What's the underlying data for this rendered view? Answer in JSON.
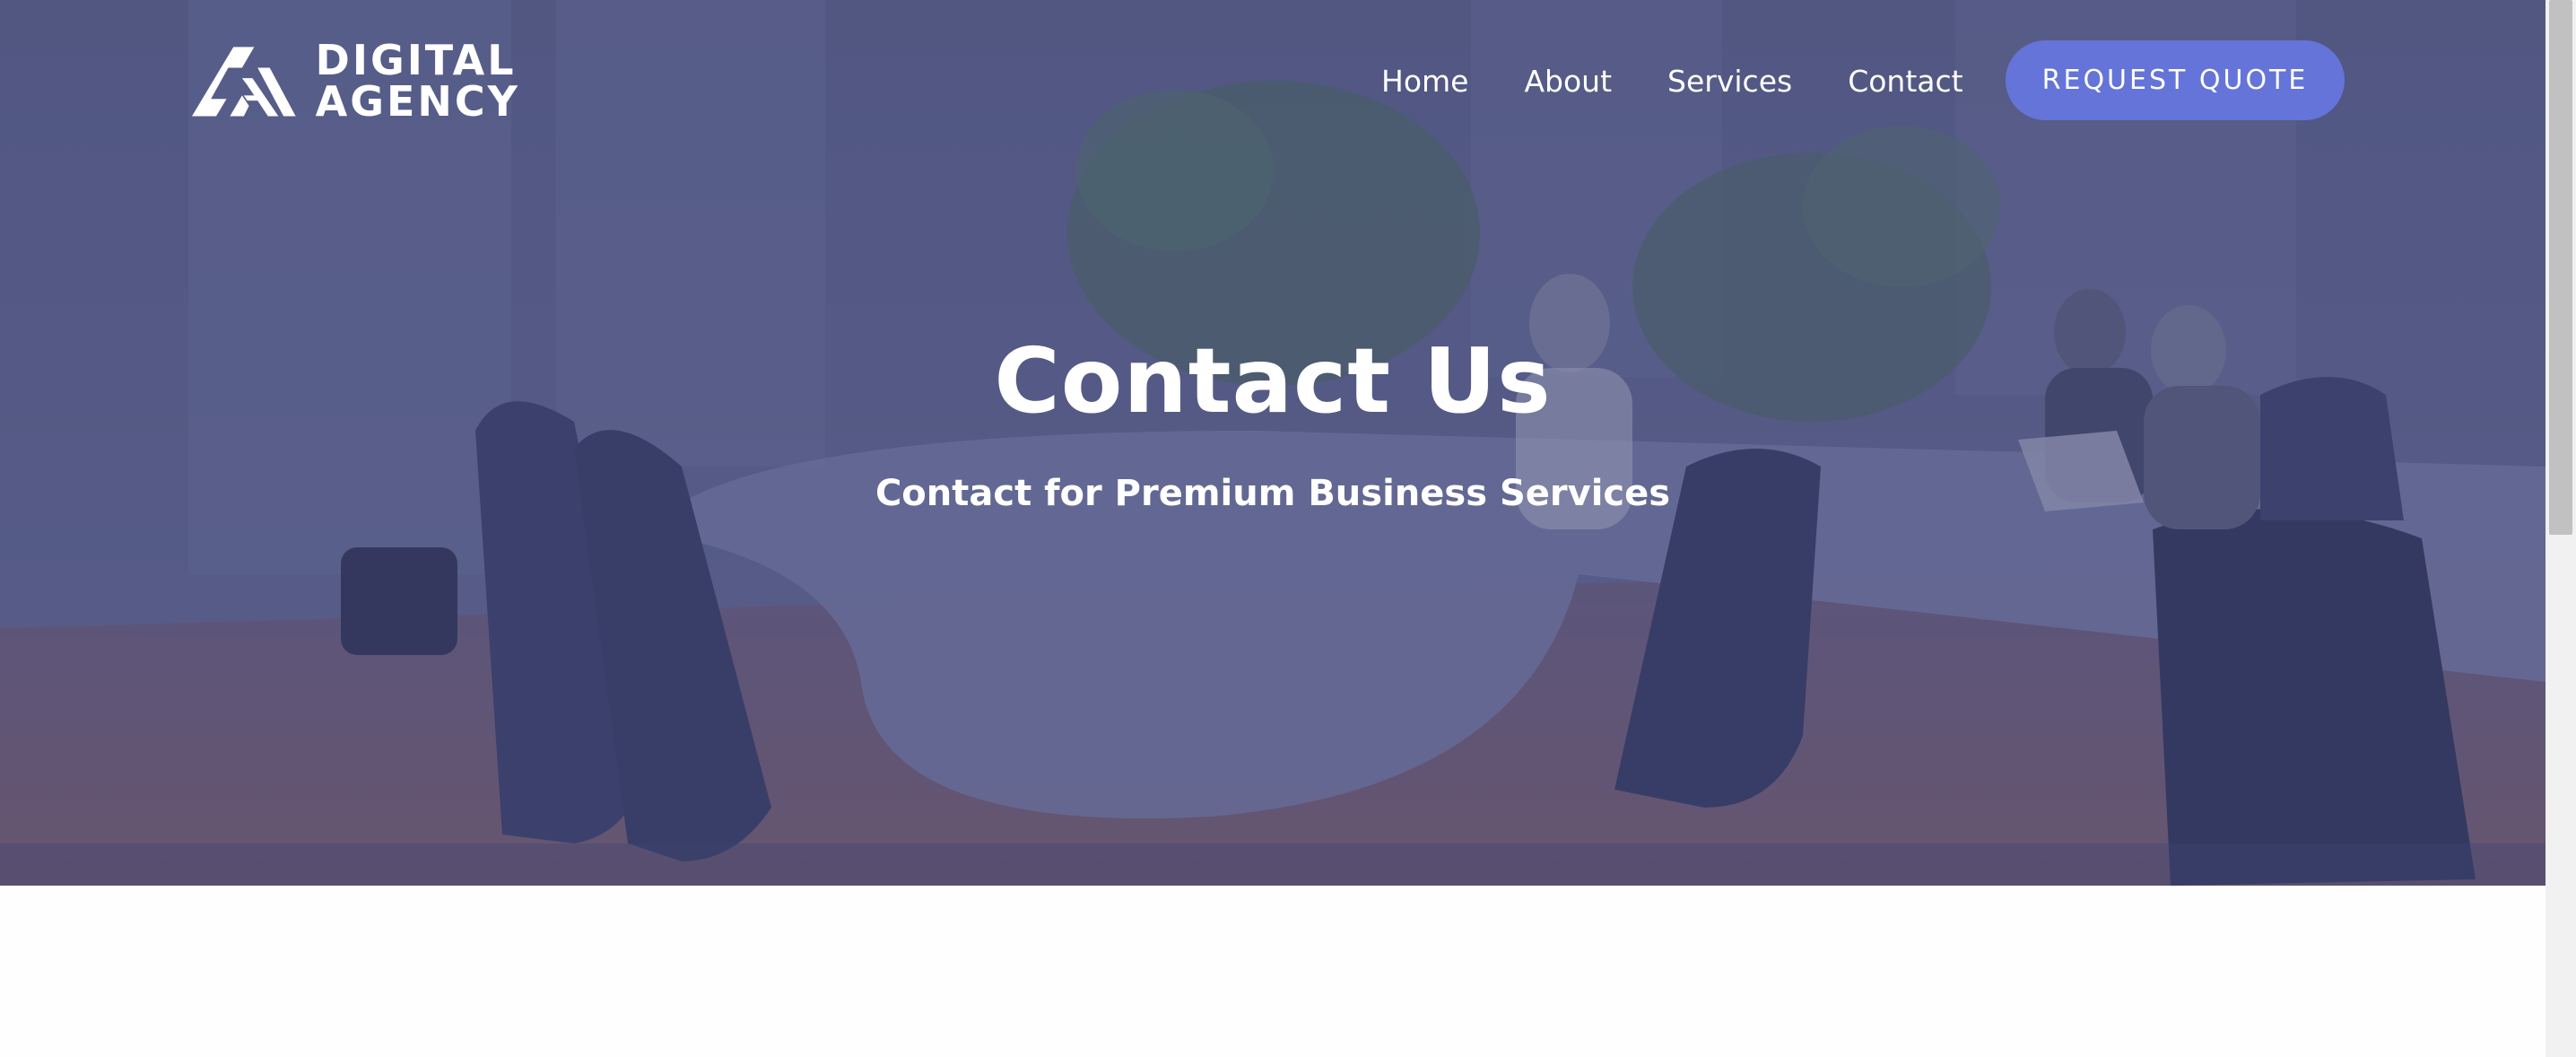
{
  "logo": {
    "line1": "DIGITAL",
    "line2": "AGENCY",
    "icon": "logo-mountain-icon"
  },
  "nav": {
    "items": [
      {
        "label": "Home"
      },
      {
        "label": "About"
      },
      {
        "label": "Services"
      },
      {
        "label": "Contact"
      }
    ],
    "cta": "REQUEST QUOTE"
  },
  "hero": {
    "title": "Contact Us",
    "subtitle": "Contact for Premium Business Services"
  },
  "colors": {
    "overlay": "#565a82",
    "accent": "#6574d8",
    "text": "#ffffff"
  }
}
